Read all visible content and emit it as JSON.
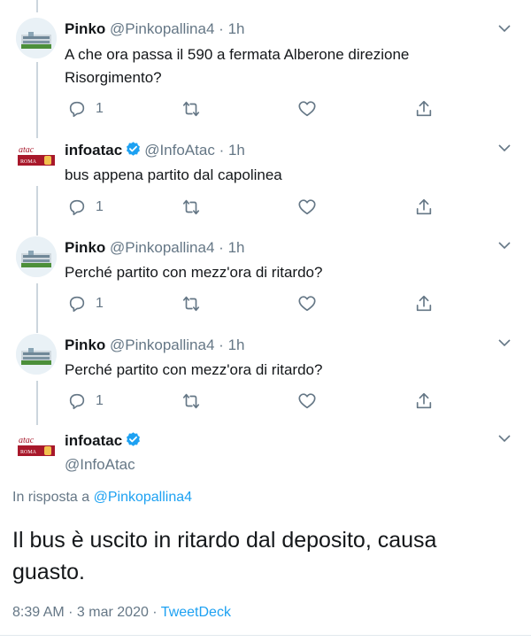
{
  "tweets": [
    {
      "name": "Pinko",
      "handle": "@Pinkopallina4",
      "time": "1h",
      "text": "A che ora passa il 590 a fermata Alberone direzione Risorgimento?",
      "replies": "1"
    },
    {
      "name": "infoatac",
      "handle": "@InfoAtac",
      "time": "1h",
      "text": "bus appena partito dal capolinea",
      "replies": "1"
    },
    {
      "name": "Pinko",
      "handle": "@Pinkopallina4",
      "time": "1h",
      "text": "Perché partito con mezz'ora di ritardo?",
      "replies": "1"
    },
    {
      "name": "Pinko",
      "handle": "@Pinkopallina4",
      "time": "1h",
      "text": "Perché partito con mezz'ora di ritardo?",
      "replies": "1"
    }
  ],
  "dot": "·",
  "main_tweet": {
    "name": "infoatac",
    "handle": "@InfoAtac",
    "reply_prefix": "In risposta a",
    "reply_to": "@Pinkopallina4",
    "text": "Il bus è uscito in ritardo dal deposito, causa guasto.",
    "timestamp": "8:39 AM · 3 mar 2020 ·",
    "source": "TweetDeck"
  },
  "avatar_text": {
    "atac": "atac",
    "roma": "ROMA"
  },
  "colors": {
    "accent": "#1da1f2",
    "muted": "#657786",
    "atac_red": "#a8182b"
  }
}
